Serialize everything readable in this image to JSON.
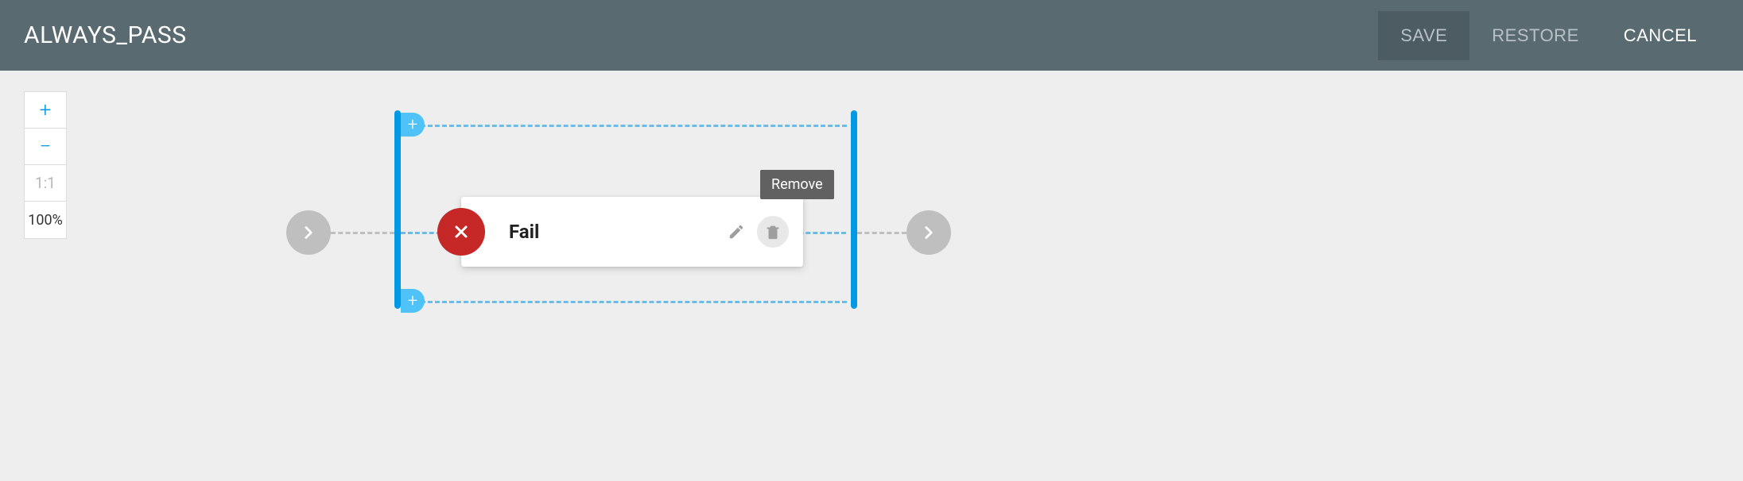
{
  "header": {
    "title": "ALWAYS_PASS",
    "save": "SAVE",
    "restore": "RESTORE",
    "cancel": "CANCEL"
  },
  "zoom": {
    "plus": "+",
    "minus": "−",
    "ratio": "1:1",
    "percent": "100%"
  },
  "node": {
    "label": "Fail"
  },
  "tooltip": {
    "remove": "Remove"
  },
  "colors": {
    "accent": "#0099e5",
    "fail": "#c62828",
    "header": "#5a6a71"
  }
}
